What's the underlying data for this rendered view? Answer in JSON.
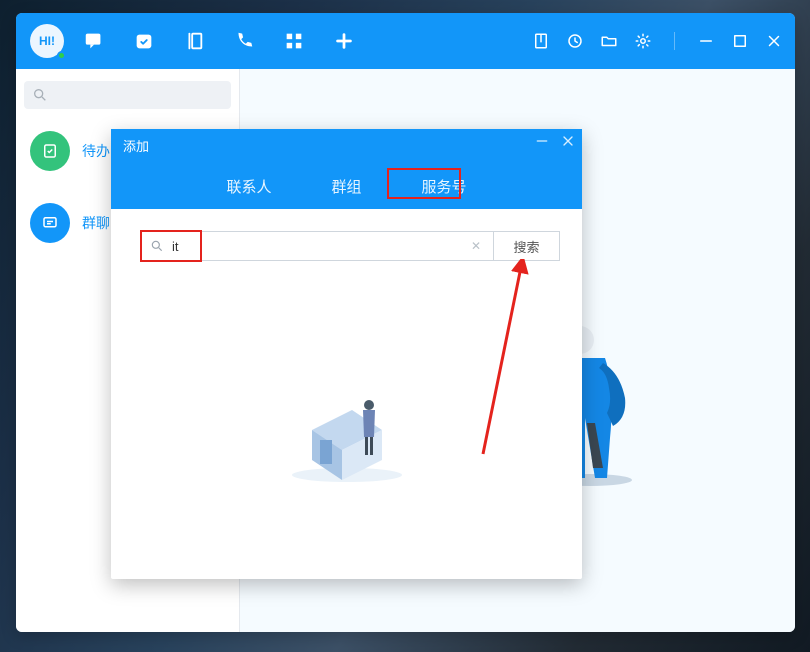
{
  "avatar_text": "HI!",
  "sidebar": {
    "items": [
      {
        "label": "待办",
        "icon": "check-list-icon",
        "color": "#33c37c"
      },
      {
        "label": "群聊",
        "icon": "chat-icon",
        "color": "#1296f9"
      }
    ]
  },
  "dialog": {
    "title": "添加",
    "tabs": [
      "联系人",
      "群组",
      "服务号"
    ],
    "search_value": "it",
    "search_placeholder": "",
    "search_button": "搜索"
  }
}
